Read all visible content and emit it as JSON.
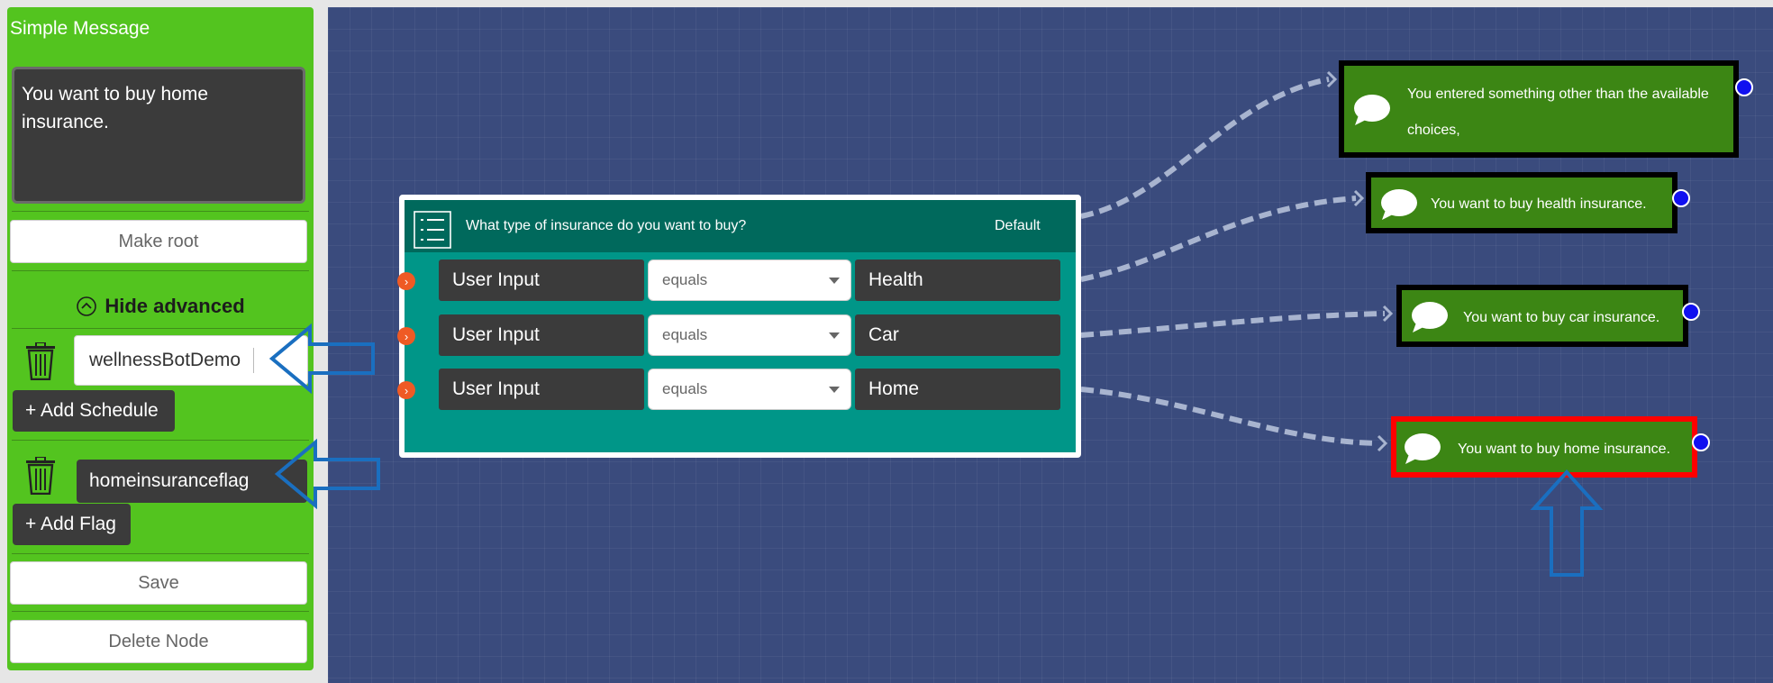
{
  "sidebar": {
    "title": "Simple Message",
    "message_text": "You want to buy home insurance.",
    "make_root_label": "Make root",
    "advanced_toggle_label": "Hide advanced",
    "schedule_value": "wellnessBotDemo",
    "add_schedule_label": "+ Add Schedule",
    "flag_value": "homeinsuranceflag",
    "add_flag_label": "+ Add Flag",
    "save_label": "Save",
    "delete_label": "Delete Node"
  },
  "decision_node": {
    "question": "What type of insurance do you want to buy?",
    "default_label": "Default",
    "rows": [
      {
        "field": "User Input",
        "operator": "equals",
        "value": "Health"
      },
      {
        "field": "User Input",
        "operator": "equals",
        "value": "Car"
      },
      {
        "field": "User Input",
        "operator": "equals",
        "value": "Home"
      }
    ]
  },
  "message_nodes": [
    {
      "text_line1": "You entered something other than the available",
      "text_line2": "choices,"
    },
    {
      "text": "You want to buy health insurance."
    },
    {
      "text": "You want to buy car insurance."
    },
    {
      "text": "You want to buy home insurance.",
      "selected": true
    }
  ],
  "colors": {
    "sidebar_green": "#53c41f",
    "canvas_blue": "#3a4b7d",
    "decision_teal": "#009688",
    "message_green": "#3c8614",
    "selected_border": "#ff0000",
    "port_blue": "#1010f0",
    "callout_blue": "#1a6fc0"
  }
}
